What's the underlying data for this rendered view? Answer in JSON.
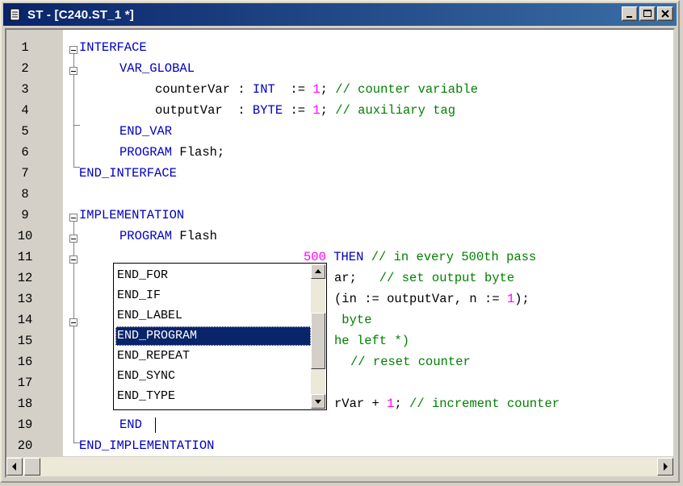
{
  "window": {
    "title": "ST - [C240.ST_1 *]",
    "icons": {
      "app": "document-icon",
      "minimize": "minimize-icon",
      "maximize": "maximize-icon",
      "close": "close-icon"
    }
  },
  "colors": {
    "keyword": "#0000c0",
    "number": "#ff00ff",
    "comment": "#008000",
    "titlebar": "#0a246a",
    "selection": "#0a246a"
  },
  "line_numbers": [
    "1",
    "2",
    "3",
    "4",
    "5",
    "6",
    "7",
    "8",
    "9",
    "10",
    "11",
    "12",
    "13",
    "14",
    "15",
    "16",
    "17",
    "18",
    "19",
    "20"
  ],
  "code": {
    "l1_kw": "INTERFACE",
    "l2_kw": "VAR_GLOBAL",
    "l3_a": "counterVar : ",
    "l3_kw": "INT",
    "l3_b": "  := ",
    "l3_num": "1",
    "l3_c": "; ",
    "l3_cm": "// counter variable",
    "l4_a": "outputVar  : ",
    "l4_kw": "BYTE",
    "l4_b": " := ",
    "l4_num": "1",
    "l4_c": "; ",
    "l4_cm": "// auxiliary tag",
    "l5_kw": "END_VAR",
    "l6_kw": "PROGRAM",
    "l6_tx": " Flash;",
    "l7_kw": "END_INTERFACE",
    "l9_kw": "IMPLEMENTATION",
    "l10_kw": "PROGRAM",
    "l10_tx": " Flash",
    "l11_num": "500",
    "l11_kw": " THEN",
    "l11_cm": " // in every 500th pass",
    "l12_a": "ar;",
    "l12_cm": "   // set output byte",
    "l13_a": "(in := outputVar, n := ",
    "l13_num": "1",
    "l13_b": ");",
    "l14_cm": " byte",
    "l15_cm": "he left *)",
    "l16_cm": "// reset counter",
    "l18_a": "rVar + ",
    "l18_num": "1",
    "l18_b": "; ",
    "l18_cm": "// increment counter",
    "l19_kw": "END",
    "l20_kw": "END_IMPLEMENTATION"
  },
  "autocomplete": {
    "items": [
      "END_FOR",
      "END_IF",
      "END_LABEL",
      "END_PROGRAM",
      "END_REPEAT",
      "END_SYNC",
      "END_TYPE"
    ],
    "selected": "END_PROGRAM"
  }
}
